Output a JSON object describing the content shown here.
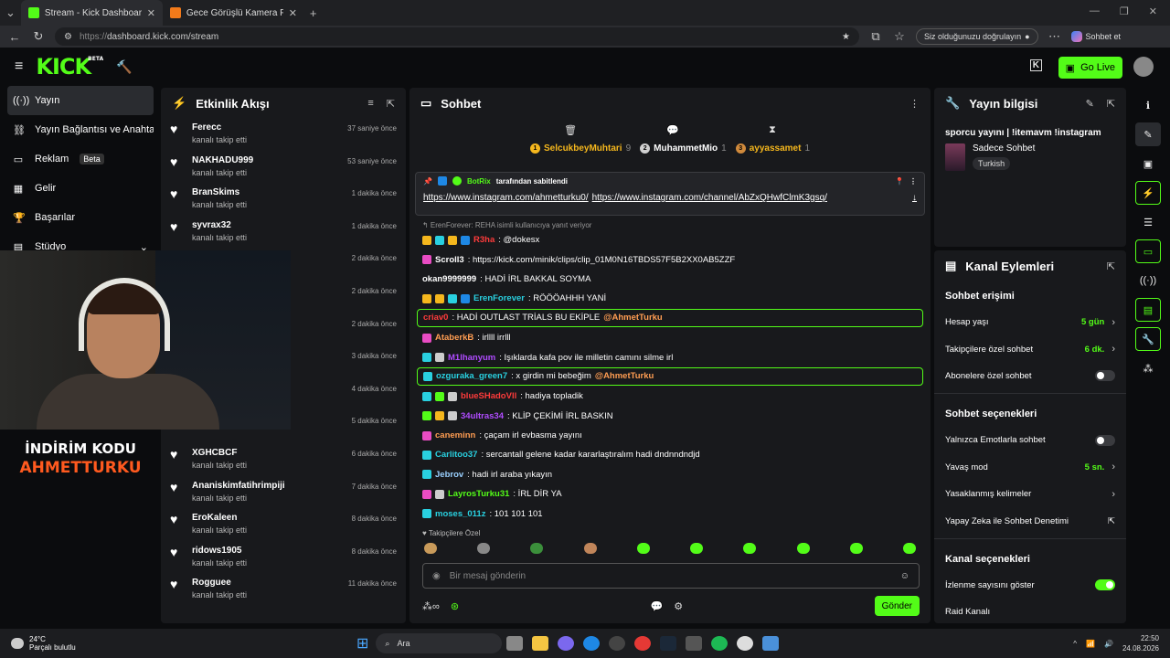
{
  "browser": {
    "tabs": [
      {
        "title": "Stream - Kick Dashboard",
        "favicon_color": "#53fc18"
      },
      {
        "title": "Gece Görüşlü Kamera Fiyatları, Mo",
        "favicon_color": "#f27a1a"
      }
    ],
    "url_prefix": "https://",
    "url_main": "dashboard.kick.com/stream",
    "verify_label": "Siz olduğunuzu doğrulayın",
    "copilot_label": "Sohbet et"
  },
  "header": {
    "logo": "KICK",
    "beta": "BETA",
    "go_live": "Go Live"
  },
  "sidebar": {
    "items": [
      {
        "icon": "((·))",
        "label": "Yayın"
      },
      {
        "icon": "⛓",
        "label": "Yayın Bağlantısı ve Anahtarı"
      },
      {
        "icon": "▭",
        "label": "Reklam",
        "badge": "Beta"
      },
      {
        "icon": "▦",
        "label": "Gelir"
      },
      {
        "icon": "🏆",
        "label": "Başarılar"
      },
      {
        "icon": "▤",
        "label": "Stüdyo"
      }
    ]
  },
  "promo": {
    "line1": "İNDİRİM KODU",
    "line2": "AHMETTURKU"
  },
  "activity": {
    "title": "Etkinlik Akışı",
    "items": [
      {
        "name": "Ferecc",
        "sub": "kanalı takip etti",
        "time": "37 saniye önce"
      },
      {
        "name": "NAKHADU999",
        "sub": "kanalı takip etti",
        "time": "53 saniye önce"
      },
      {
        "name": "BranSkims",
        "sub": "kanalı takip etti",
        "time": "1 dakika önce"
      },
      {
        "name": "syvrax32",
        "sub": "kanalı takip etti",
        "time": "1 dakika önce"
      },
      {
        "name": "",
        "sub": "",
        "time": "2 dakika önce"
      },
      {
        "name": "",
        "sub": "",
        "time": "2 dakika önce"
      },
      {
        "name": "",
        "sub": "",
        "time": "2 dakika önce"
      },
      {
        "name": "",
        "sub": "",
        "time": "3 dakika önce"
      },
      {
        "name": "",
        "sub": "",
        "time": "4 dakika önce"
      },
      {
        "name": "",
        "sub": "kanalı takip etti",
        "time": "5 dakika önce"
      },
      {
        "name": "XGHCBCF",
        "sub": "kanalı takip etti",
        "time": "6 dakika önce"
      },
      {
        "name": "Ananiskimfatihrimpiji",
        "sub": "kanalı takip etti",
        "time": "7 dakika önce"
      },
      {
        "name": "EroKaleen",
        "sub": "kanalı takip etti",
        "time": "8 dakika önce"
      },
      {
        "name": "ridows1905",
        "sub": "kanalı takip etti",
        "time": "8 dakika önce"
      },
      {
        "name": "Rogguee",
        "sub": "kanalı takip etti",
        "time": "11 dakika önce"
      }
    ]
  },
  "chat": {
    "title": "Sohbet",
    "leaders": [
      {
        "rank": "1",
        "name": "SelcukbeyMuhtari",
        "count": "9",
        "color": "#f5b71d",
        "name_color": "#f5b71d"
      },
      {
        "rank": "2",
        "name": "MuhammetMio",
        "count": "1",
        "color": "#d0d0d0",
        "name_color": "#ffffff"
      },
      {
        "rank": "3",
        "name": "ayyassamet",
        "count": "1",
        "color": "#d08a3c",
        "name_color": "#f5b71d"
      }
    ],
    "pinned": {
      "user": "BotRix",
      "suffix": "tarafından sabitlendi",
      "link1": "https://www.instagram.com/ahmetturku0/",
      "link2": "https://www.instagram.com/channel/AbZxQHwfClmK3gsq/"
    },
    "reply_note": "↰ ErenForever: REHA isimli kullanıcıya yanıt veriyor",
    "messages": [
      {
        "user": "R3ha",
        "text": ": @dokesx",
        "color": "#ff3b3b",
        "badges": [
          "#f5b71d",
          "#29d0e0",
          "#f5b71d",
          "#1e88e5"
        ]
      },
      {
        "user": "Scroll3",
        "text": ": https://kick.com/minik/clips/clip_01M0N16TBDS57F5B2XX0AB5ZZF",
        "color": "#ffffff",
        "badges": [
          "#e94cc3"
        ]
      },
      {
        "user": "okan9999999",
        "text": ": HADİ İRL BAKKAL SOYMA",
        "color": "#ffffff",
        "badges": []
      },
      {
        "user": "ErenForever",
        "text": ": RÖÖÖAHHH YANİ",
        "color": "#29d0e0",
        "badges": [
          "#f5b71d",
          "#f5b71d",
          "#29d0e0",
          "#1e88e5"
        ]
      },
      {
        "user": "criav0",
        "text": ": HADİ OUTLAST TRİALS BU EKİPLE ",
        "mention": "@AhmetTurku",
        "color": "#ff3b3b",
        "badges": [],
        "highlight": true
      },
      {
        "user": "AtaberkB",
        "text": ": irllll irrlll",
        "color": "#ff9d52",
        "badges": [
          "#e94cc3"
        ]
      },
      {
        "user": "M1lhanyum",
        "text": ": Işıklarda kafa pov ile milletin camını silme irl",
        "color": "#b04cff",
        "badges": [
          "#29d0e0",
          "#cccccc"
        ]
      },
      {
        "user": "ozguraka_green7",
        "text": ": x girdin mi bebeğim ",
        "mention": "@AhmetTurku",
        "color": "#29d0e0",
        "badges": [
          "#29d0e0"
        ],
        "highlight": true
      },
      {
        "user": "blueSHadoVll",
        "text": ": hadiya topladik",
        "color": "#ff3b3b",
        "badges": [
          "#29d0e0",
          "#53fc18",
          "#cccccc"
        ]
      },
      {
        "user": "34ultras34",
        "text": ": KLİP ÇEKİMİ İRL BASKIN",
        "color": "#b04cff",
        "badges": [
          "#53fc18",
          "#f5b71d",
          "#cccccc"
        ]
      },
      {
        "user": "caneminn",
        "text": ": çaçam irl evbasma yayını",
        "color": "#ff9d52",
        "badges": [
          "#e94cc3"
        ]
      },
      {
        "user": "Carlitoo37",
        "text": ": sercantall gelene kadar kararlaştıralım hadi dndnndndjd",
        "color": "#29d0e0",
        "badges": [
          "#29d0e0"
        ]
      },
      {
        "user": "Jebrov",
        "text": ": hadi irl araba yıkayın",
        "color": "#9ad0ff",
        "badges": [
          "#29d0e0"
        ]
      },
      {
        "user": "LayrosTurku31",
        "text": ": İRL DİR YA",
        "color": "#53fc18",
        "badges": [
          "#e94cc3",
          "#cccccc"
        ]
      },
      {
        "user": "moses_011z",
        "text": ": 101 101 101",
        "color": "#29d0e0",
        "badges": [
          "#29d0e0"
        ]
      }
    ],
    "emote_label": "♥ Takipçilere Özel",
    "input_placeholder": "Bir mesaj gönderin",
    "send_label": "Gönder"
  },
  "stream_info": {
    "title": "Yayın bilgisi",
    "stream_title": "sporcu yayını | !itemavm !instagram",
    "category": "Sadece Sohbet",
    "tag": "Turkish"
  },
  "channel_actions": {
    "title": "Kanal Eylemleri",
    "sections": [
      {
        "heading": "Sohbet erişimi",
        "options": [
          {
            "label": "Hesap yaşı",
            "value": "5 gün",
            "kind": "chevron"
          },
          {
            "label": "Takipçilere özel sohbet",
            "value": "6 dk.",
            "kind": "chevron"
          },
          {
            "label": "Abonelere özel sohbet",
            "value": "",
            "kind": "toggle-off"
          }
        ]
      },
      {
        "heading": "Sohbet seçenekleri",
        "options": [
          {
            "label": "Yalnızca Emotlarla sohbet",
            "value": "",
            "kind": "toggle-off"
          },
          {
            "label": "Yavaş mod",
            "value": "5 sn.",
            "kind": "chevron"
          },
          {
            "label": "Yasaklanmış kelimeler",
            "value": "",
            "kind": "chevron"
          },
          {
            "label": "Yapay Zeka ile Sohbet Denetimi",
            "value": "",
            "kind": "external"
          }
        ]
      },
      {
        "heading": "Kanal seçenekleri",
        "options": [
          {
            "label": "İzlenme sayısını göster",
            "value": "",
            "kind": "toggle-on"
          },
          {
            "label": "Raid Kanalı",
            "value": "",
            "kind": "none"
          }
        ]
      }
    ]
  },
  "taskbar": {
    "temp": "24°C",
    "weather": "Parçalı bulutlu",
    "search": "Ara",
    "time": "22:50",
    "date": "24.08.2026"
  }
}
